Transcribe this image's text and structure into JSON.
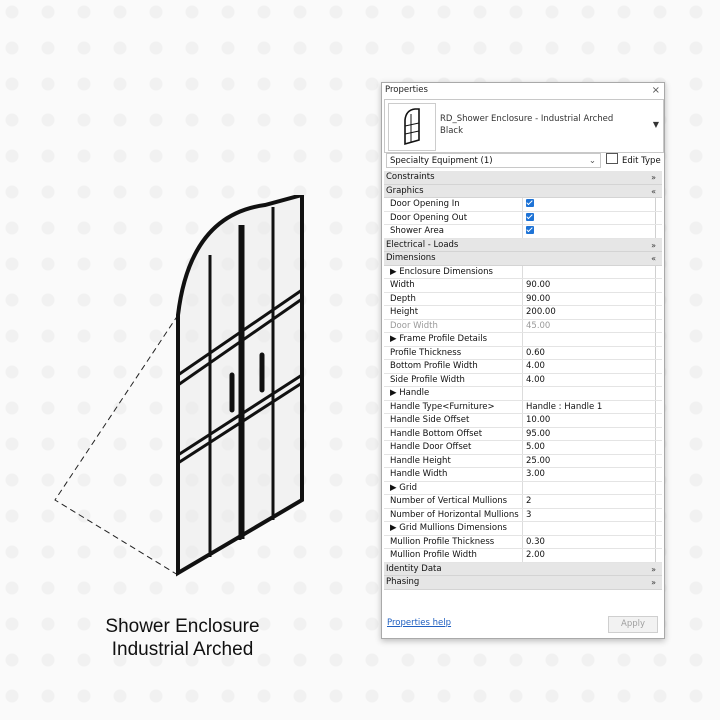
{
  "caption": {
    "line1": "Shower Enclosure",
    "line2": "Industrial Arched"
  },
  "panel": {
    "title": "Properties",
    "type_name_line1": "RD_Shower Enclosure - Industrial Arched",
    "type_name_line2": "Black",
    "filter": "Specialty Equipment (1)",
    "edit_type": "Edit Type",
    "properties_help": "Properties help",
    "apply": "Apply"
  },
  "rows": [
    {
      "kind": "section",
      "label": "Constraints",
      "toggle": "»"
    },
    {
      "kind": "section",
      "label": "Graphics",
      "toggle": "«"
    },
    {
      "kind": "check",
      "label": "Door Opening In",
      "checked": true
    },
    {
      "kind": "check",
      "label": "Door Opening Out",
      "checked": true
    },
    {
      "kind": "check",
      "label": "Shower Area",
      "checked": true
    },
    {
      "kind": "section",
      "label": "Electrical - Loads",
      "toggle": "»"
    },
    {
      "kind": "section",
      "label": "Dimensions",
      "toggle": "«"
    },
    {
      "kind": "group",
      "label": "▶ Enclosure Dimensions",
      "value": ""
    },
    {
      "kind": "param",
      "label": "Width",
      "value": "90.00"
    },
    {
      "kind": "param",
      "label": "Depth",
      "value": "90.00"
    },
    {
      "kind": "param",
      "label": "Height",
      "value": "200.00"
    },
    {
      "kind": "grey",
      "label": "Door Width",
      "value": "45.00"
    },
    {
      "kind": "group",
      "label": "▶ Frame Profile Details",
      "value": ""
    },
    {
      "kind": "param",
      "label": "Profile Thickness",
      "value": "0.60"
    },
    {
      "kind": "param",
      "label": "Bottom Profile Width",
      "value": "4.00"
    },
    {
      "kind": "param",
      "label": "Side Profile Width",
      "value": "4.00"
    },
    {
      "kind": "group",
      "label": "▶ Handle",
      "value": ""
    },
    {
      "kind": "param",
      "label": "Handle Type<Furniture>",
      "value": "Handle : Handle 1"
    },
    {
      "kind": "param",
      "label": "Handle Side Offset",
      "value": "10.00"
    },
    {
      "kind": "param",
      "label": "Handle Bottom Offset",
      "value": "95.00"
    },
    {
      "kind": "param",
      "label": "Handle Door Offset",
      "value": "5.00"
    },
    {
      "kind": "param",
      "label": "Handle Height",
      "value": "25.00"
    },
    {
      "kind": "param",
      "label": "Handle Width",
      "value": "3.00"
    },
    {
      "kind": "group",
      "label": "▶ Grid",
      "value": ""
    },
    {
      "kind": "param",
      "label": "Number of Vertical Mullions",
      "value": "2"
    },
    {
      "kind": "param",
      "label": "Number of Horizontal Mullions",
      "value": "3"
    },
    {
      "kind": "group",
      "label": "▶ Grid Mullions Dimensions",
      "value": ""
    },
    {
      "kind": "param",
      "label": "Mullion Profile Thickness",
      "value": "0.30"
    },
    {
      "kind": "param",
      "label": "Mullion Profile Width",
      "value": "2.00"
    },
    {
      "kind": "section",
      "label": "Identity Data",
      "toggle": "»"
    },
    {
      "kind": "section",
      "label": "Phasing",
      "toggle": "»"
    }
  ]
}
